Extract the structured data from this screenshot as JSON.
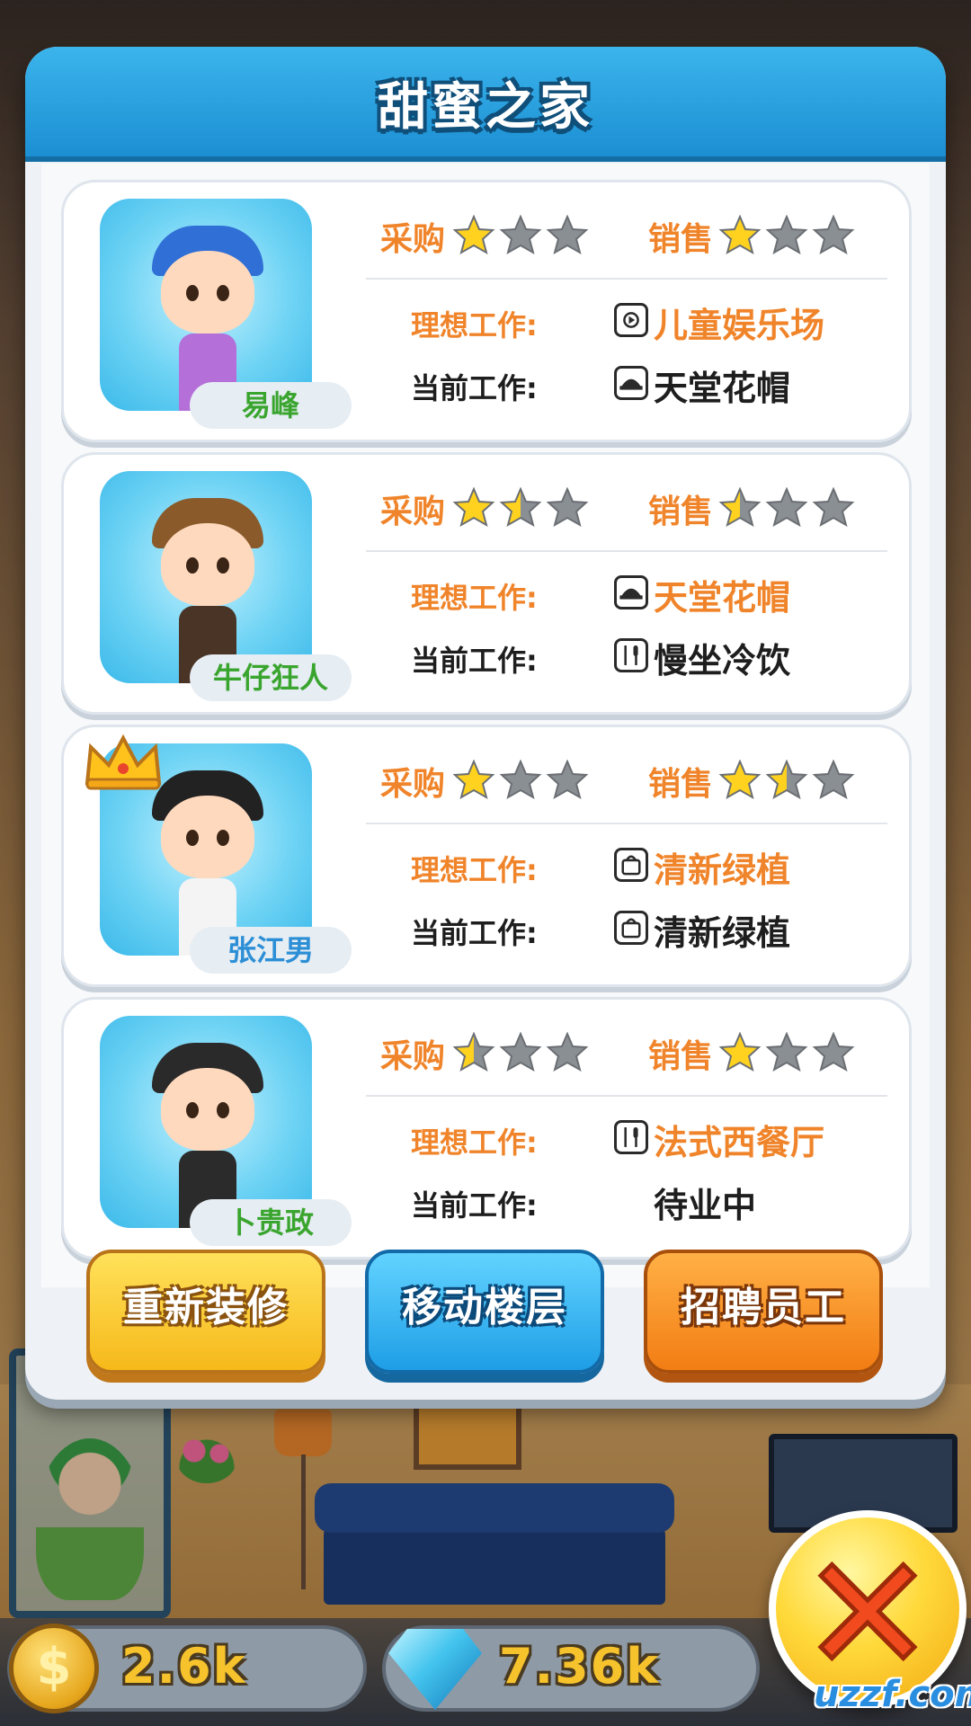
{
  "title": "甜蜜之家",
  "labels": {
    "purchase": "采购",
    "sales": "销售",
    "ideal_job": "理想工作:",
    "current_job": "当前工作:"
  },
  "employees": [
    {
      "name": "易峰",
      "name_color": "#3aa52e",
      "purchase_stars": 1,
      "sales_stars": 1,
      "ideal_job": "儿童娱乐场",
      "ideal_job_icon": "film-icon",
      "current_job": "天堂花帽",
      "current_job_icon": "hat-icon",
      "crowned": false
    },
    {
      "name": "牛仔狂人",
      "name_color": "#3aa52e",
      "purchase_stars": 1.5,
      "sales_stars": 0.5,
      "ideal_job": "天堂花帽",
      "ideal_job_icon": "hat-icon",
      "current_job": "慢坐冷饮",
      "current_job_icon": "utensils-icon",
      "crowned": false
    },
    {
      "name": "张江男",
      "name_color": "#2c8fd6",
      "purchase_stars": 1,
      "sales_stars": 1.5,
      "ideal_job": "清新绿植",
      "ideal_job_icon": "bag-icon",
      "current_job": "清新绿植",
      "current_job_icon": "bag-icon",
      "crowned": true
    },
    {
      "name": "卜贵政",
      "name_color": "#3aa52e",
      "purchase_stars": 0.5,
      "sales_stars": 1,
      "ideal_job": "法式西餐厅",
      "ideal_job_icon": "utensils-icon",
      "current_job": "待业中",
      "current_job_icon": "",
      "crowned": false
    }
  ],
  "buttons": {
    "redecorate": "重新装修",
    "move_floor": "移动楼层",
    "hire_staff": "招聘员工"
  },
  "hud": {
    "coins": "2.6k",
    "gems": "7.36k"
  },
  "watermark": "uzzf.com",
  "colors": {
    "header_blue": "#1c8fd3",
    "accent_orange": "#f0842a",
    "star_gold": "#ffd21f",
    "star_grey": "#8a8f94"
  }
}
